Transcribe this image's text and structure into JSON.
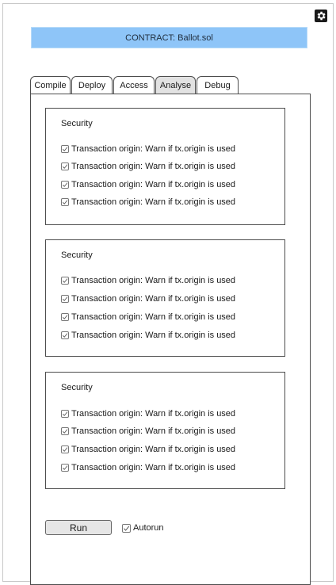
{
  "header": {
    "contract_label": "CONTRACT: Ballot.sol",
    "settings_icon": "gear-icon"
  },
  "tabs": [
    {
      "label": "Compile",
      "active": false
    },
    {
      "label": "Deploy",
      "active": false
    },
    {
      "label": "Access",
      "active": false
    },
    {
      "label": "Analyse",
      "active": true
    },
    {
      "label": "Debug",
      "active": false
    }
  ],
  "groups": [
    {
      "title": "Security",
      "options": [
        {
          "label": "Transaction origin: Warn if tx.origin is used",
          "checked": true
        },
        {
          "label": "Transaction origin: Warn if tx.origin is used",
          "checked": true
        },
        {
          "label": "Transaction origin: Warn if tx.origin is used",
          "checked": true
        },
        {
          "label": "Transaction origin: Warn if tx.origin is used",
          "checked": true
        }
      ]
    },
    {
      "title": "Security",
      "options": [
        {
          "label": "Transaction origin: Warn if tx.origin is used",
          "checked": true
        },
        {
          "label": "Transaction origin: Warn if tx.origin is used",
          "checked": true
        },
        {
          "label": "Transaction origin: Warn if tx.origin is used",
          "checked": true
        },
        {
          "label": "Transaction origin: Warn if tx.origin is used",
          "checked": true
        }
      ]
    },
    {
      "title": "Security",
      "options": [
        {
          "label": "Transaction origin: Warn if tx.origin is used",
          "checked": true
        },
        {
          "label": "Transaction origin: Warn if tx.origin is used",
          "checked": true
        },
        {
          "label": "Transaction origin: Warn if tx.origin is used",
          "checked": true
        },
        {
          "label": "Transaction origin: Warn if tx.origin is used",
          "checked": true
        }
      ]
    }
  ],
  "actions": {
    "run_label": "Run",
    "autorun_label": "Autorun",
    "autorun_checked": true
  },
  "colors": {
    "banner": "#8ec5f8",
    "active_tab": "#e2e2e2",
    "run_button": "#e6e6e6"
  }
}
